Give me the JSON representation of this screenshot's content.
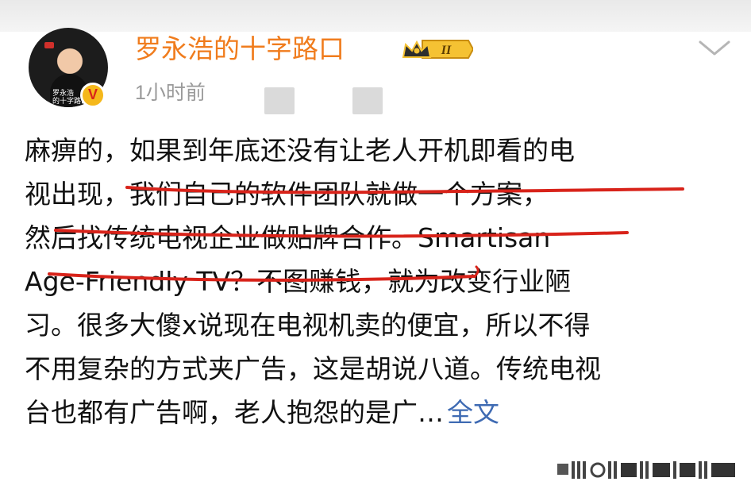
{
  "post": {
    "author": {
      "name": "罗永浩的十字路口",
      "verified_icon": "verified-v-badge",
      "verified_letter": "V",
      "level_icon": "crown-level-badge",
      "avatar_caption_line1": "罗永浩",
      "avatar_caption_line2": "的十字路口"
    },
    "time": "1小时前",
    "menu_icon": "chevron-down-icon",
    "body_lines": [
      "麻痹的，如果到年底还没有让老人开机即看的电",
      "视出现，我们自己的软件团队就做一个方案，",
      "然后找传统电视企业做贴牌合作。Smartisan",
      "Age-Friendly TV？不图赚钱，就为改变行业陋",
      "习。很多大傻x说现在电视机卖的便宜，所以不得",
      "不用复杂的方式夹广告，这是胡说八道。传统电视",
      "台也都有广告啊，老人抱怨的是广…"
    ],
    "full_text_link": "全文",
    "highlight_color": "#d8231a"
  },
  "colors": {
    "username": "#f07c1d",
    "time": "#9a9a9a",
    "link": "#3f6bb3",
    "badge_gold": "#f5b81b"
  }
}
